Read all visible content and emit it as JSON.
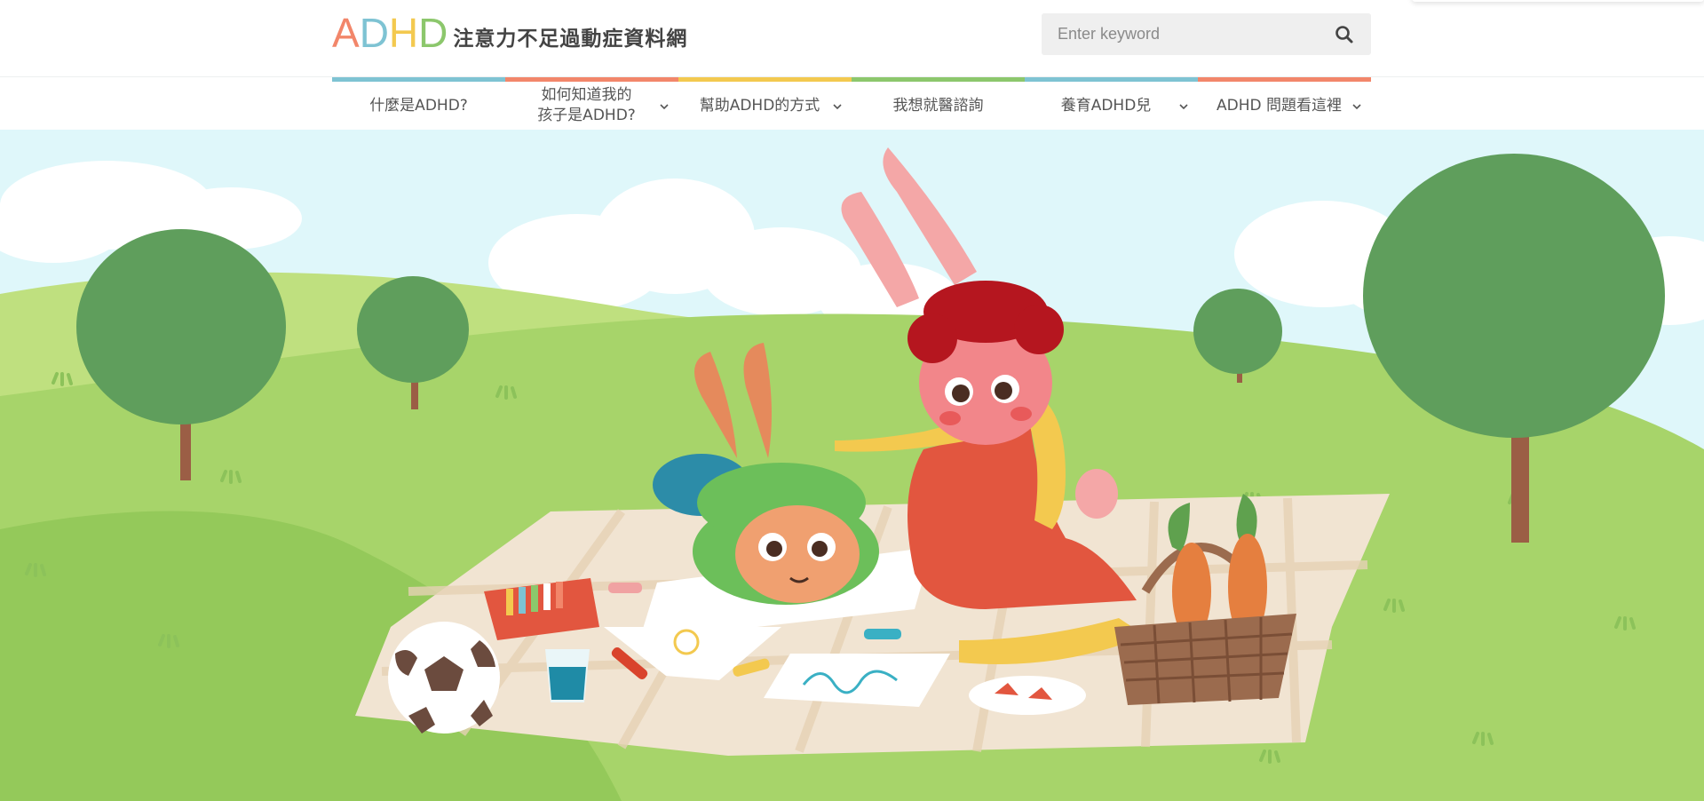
{
  "logo": {
    "letters": [
      "A",
      "D",
      "H",
      "D"
    ],
    "letter_colors": [
      "#f2866a",
      "#7ec3d3",
      "#f3c94f",
      "#8cc76c"
    ],
    "site_name": "注意力不足過動症資料網"
  },
  "search": {
    "placeholder": "Enter keyword",
    "icon": "search-icon"
  },
  "nav": {
    "items": [
      {
        "label": "什麼是ADHD?",
        "has_dropdown": false,
        "color": "#7ec3d3"
      },
      {
        "label": "如何知道我的\n孩子是ADHD?",
        "has_dropdown": true,
        "color": "#f2866a"
      },
      {
        "label": "幫助ADHD的方式",
        "has_dropdown": true,
        "color": "#f3c94f"
      },
      {
        "label": "我想就醫諮詢",
        "has_dropdown": false,
        "color": "#8cc76c"
      },
      {
        "label": "養育ADHD兒",
        "has_dropdown": true,
        "color": "#7ec3d3"
      },
      {
        "label": "ADHD 問題看這裡",
        "has_dropdown": true,
        "color": "#f2866a"
      }
    ]
  },
  "hero": {
    "illustration": "picnic-illustration",
    "colors": {
      "sky": "#dff7fa",
      "hill": "#a7d46a",
      "tree": "#5f9e5c",
      "blanket": "#f1e4d2"
    }
  }
}
